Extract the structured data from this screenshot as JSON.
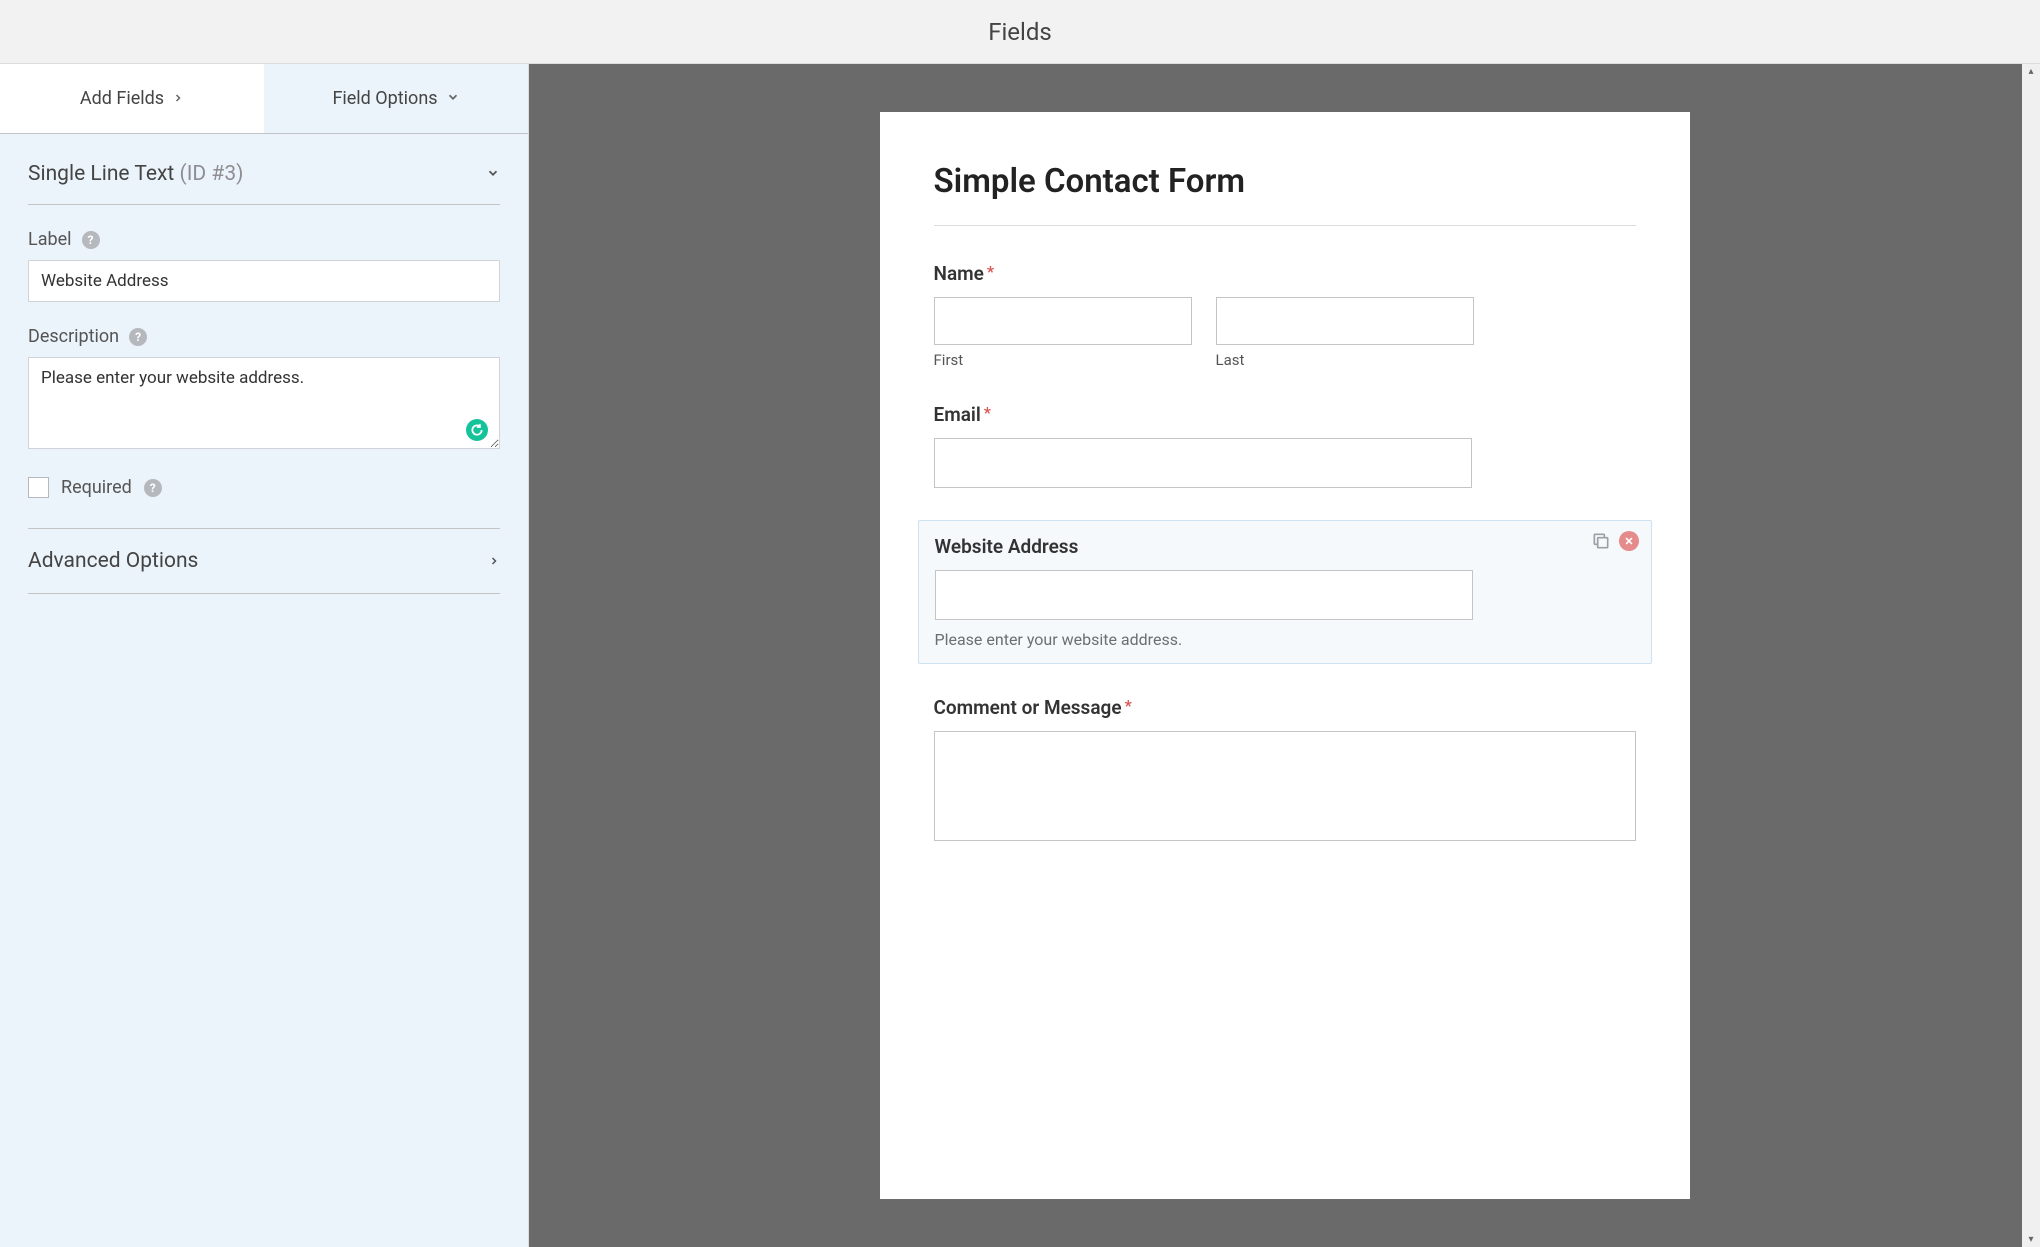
{
  "topbar": {
    "title": "Fields"
  },
  "tabs": {
    "add_fields": "Add Fields",
    "field_options": "Field Options"
  },
  "field_panel": {
    "type_label": "Single Line Text",
    "id_meta": "(ID #3)",
    "label_heading": "Label",
    "label_value": "Website Address",
    "description_heading": "Description",
    "description_value": "Please enter your website address.",
    "required_label": "Required",
    "advanced_label": "Advanced Options"
  },
  "preview": {
    "form_title": "Simple Contact Form",
    "name": {
      "label": "Name",
      "required": true,
      "first_sublabel": "First",
      "last_sublabel": "Last"
    },
    "email": {
      "label": "Email",
      "required": true
    },
    "website": {
      "label": "Website Address",
      "description": "Please enter your website address."
    },
    "comment": {
      "label": "Comment or Message",
      "required": true
    }
  }
}
